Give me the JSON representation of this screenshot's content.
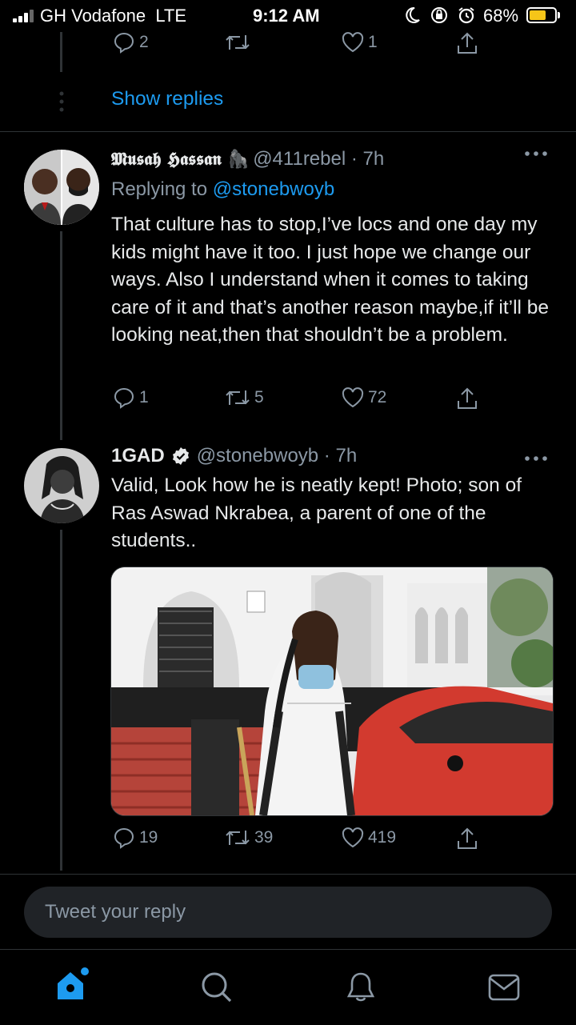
{
  "status_bar": {
    "carrier": "GH Vodafone  LTE",
    "time": "9:12 AM",
    "battery_percent": "68%",
    "battery_level": 0.68,
    "battery_color": "#f5c518"
  },
  "previous_tweet": {
    "reply_count": "2",
    "retweet_count": "",
    "like_count": "1",
    "show_replies_label": "Show replies"
  },
  "tweets": [
    {
      "display_name": "𝕸𝖚𝖘𝖆𝖍 𝕳𝖆𝖘𝖘𝖆𝖓 🦍",
      "handle_time": "@411rebel · 7h",
      "replying_to_prefix": "Replying to ",
      "replying_to_handle": "@stonebwoyb",
      "text": "That culture has to stop,I’ve locs and one day my kids might have it too. I just hope we change our ways. Also I understand when it comes to taking care of it and that’s another reason maybe,if it’ll be looking neat,then that shouldn’t be a problem.",
      "reply_count": "1",
      "retweet_count": "5",
      "like_count": "72",
      "more_icon": "more-dots-icon"
    },
    {
      "display_name": "1GAD",
      "verified": true,
      "handle_time": "@stonebwoyb · 7h",
      "text": "Valid, Look how he is neatly kept! Photo; son of Ras Aswad Nkrabea, a parent of one of the students..",
      "reply_count": "19",
      "retweet_count": "39",
      "like_count": "419",
      "more_icon": "more-dots-icon"
    }
  ],
  "reply_composer": {
    "placeholder": "Tweet your reply"
  },
  "tab_bar": {
    "items": [
      "home-icon",
      "search-icon",
      "notifications-icon",
      "messages-icon"
    ],
    "active_color": "#1d9bf0"
  },
  "colors": {
    "accent": "#1d9bf0",
    "muted": "#8b98a5",
    "background": "#000000"
  }
}
